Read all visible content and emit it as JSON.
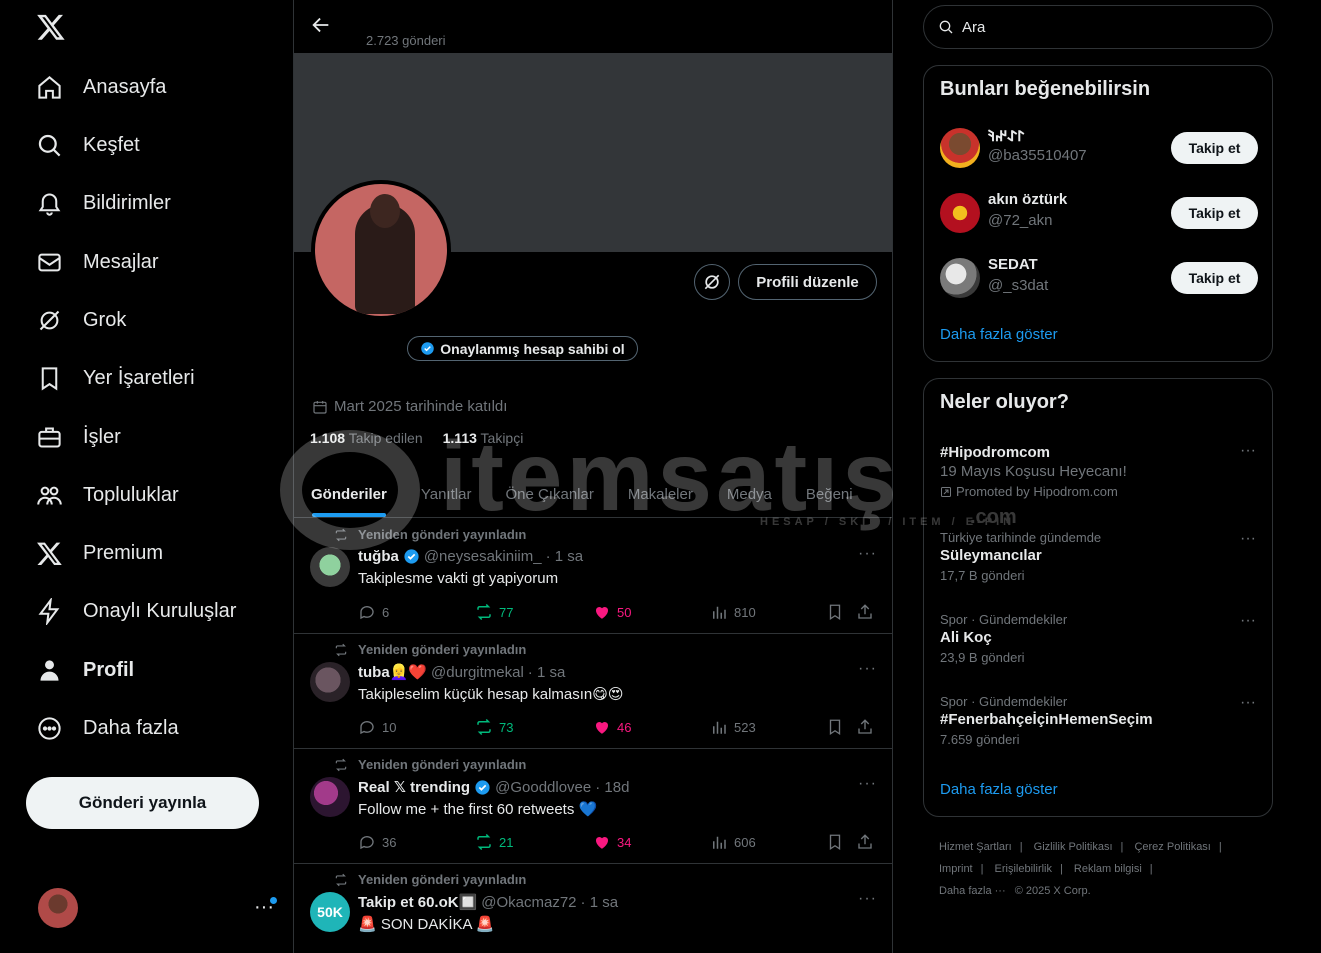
{
  "nav": {
    "items": [
      {
        "label": "Anasayfa",
        "icon": "home-icon"
      },
      {
        "label": "Keşfet",
        "icon": "search-icon"
      },
      {
        "label": "Bildirimler",
        "icon": "bell-icon"
      },
      {
        "label": "Mesajlar",
        "icon": "mail-icon"
      },
      {
        "label": "Grok",
        "icon": "grok-icon"
      },
      {
        "label": "Yer İşaretleri",
        "icon": "bookmark-icon"
      },
      {
        "label": "İşler",
        "icon": "briefcase-icon"
      },
      {
        "label": "Topluluklar",
        "icon": "people-icon"
      },
      {
        "label": "Premium",
        "icon": "x-logo-icon"
      },
      {
        "label": "Onaylı Kuruluşlar",
        "icon": "lightning-icon"
      },
      {
        "label": "Profil",
        "icon": "person-icon"
      },
      {
        "label": "Daha fazla",
        "icon": "more-circle-icon"
      }
    ],
    "post_button": "Gönderi yayınla",
    "account_more": "···"
  },
  "profile": {
    "post_count": "2.723 gönderi",
    "edit_button": "Profili düzenle",
    "verify_pill": "Onaylanmış hesap sahibi ol",
    "joined": "Mart 2025 tarihinde katıldı",
    "following_count": "1.108",
    "following_label": "Takip edilen",
    "followers_count": "1.113",
    "followers_label": "Takipçi"
  },
  "tabs": [
    "Gönderiler",
    "Yanıtlar",
    "Öne Çıkanlar",
    "Makaleler",
    "Medya",
    "Beğeni"
  ],
  "posts": [
    {
      "repost": "Yeniden gönderi yayınladın",
      "name": "tuğba",
      "verified": true,
      "handle": "@neysesakiniim_",
      "time": "· 1 sa",
      "text": "Takiplesme vakti gt yapiyorum",
      "replies": "6",
      "reposts": "77",
      "likes": "50",
      "views": "810"
    },
    {
      "repost": "Yeniden gönderi yayınladın",
      "name": "tuba👱‍♀️❤️",
      "verified": false,
      "handle": "@durgitmekal",
      "time": "· 1 sa",
      "text": "Takipleselim küçük hesap kalmasın😋😍",
      "replies": "10",
      "reposts": "73",
      "likes": "46",
      "views": "523"
    },
    {
      "repost": "Yeniden gönderi yayınladın",
      "name": "Real 𝕏 trending",
      "verified": true,
      "handle": "@Gooddlovee",
      "time": "· 18d",
      "text": "Follow me + the first 60 retweets 💙",
      "replies": "36",
      "reposts": "21",
      "likes": "34",
      "views": "606"
    },
    {
      "repost": "Yeniden gönderi yayınladın",
      "name": "Takip et 60.oK🔲",
      "verified": false,
      "handle": "@Okacmaz72",
      "time": "· 1 sa",
      "text": "🚨 SON DAKİKA 🚨",
      "replies": "",
      "reposts": "",
      "likes": "",
      "views": ""
    }
  ],
  "search": {
    "placeholder": "Ara"
  },
  "suggestions": {
    "title": "Bunları beğenebilirsin",
    "follow_label": "Takip et",
    "show_more": "Daha fazla göster",
    "users": [
      {
        "name": "𐰃𐰀𐰤𐰚",
        "handle": "@ba35510407"
      },
      {
        "name": "akın öztürk",
        "handle": "@72_akn"
      },
      {
        "name": "SEDAT",
        "handle": "@_s3dat"
      }
    ]
  },
  "trends": {
    "title": "Neler oluyor?",
    "show_more": "Daha fazla göster",
    "items": [
      {
        "title": "#Hipodromcom",
        "subtitle": "19 Mayıs Koşusu Heyecanı!",
        "promo": "Promoted by Hipodrom.com"
      },
      {
        "context": "Türkiye tarihinde gündemde",
        "title": "Süleymancılar",
        "count": "17,7 B gönderi"
      },
      {
        "context": "Spor · Gündemdekiler",
        "title": "Ali Koç",
        "count": "23,9 B gönderi"
      },
      {
        "context": "Spor · Gündemdekiler",
        "title": "#FenerbahçeİçinHemenSeçim",
        "count": "7.659 gönderi"
      }
    ]
  },
  "footer": {
    "links": [
      "Hizmet Şartları",
      "Gizlilik Politikası",
      "Çerez Politikası",
      "Imprint",
      "Erişilebilirlik",
      "Reklam bilgisi",
      "Daha fazla ···",
      "© 2025 X Corp."
    ]
  },
  "watermark": {
    "word": "itemsatış",
    "tag": "HESAP / SKIN / ITEM / E-PIN",
    "com": ".com"
  },
  "colors": {
    "accent": "#1d9bf0",
    "repost": "#00ba7c",
    "like": "#f91880",
    "muted": "#71767b",
    "border": "#2f3336"
  }
}
